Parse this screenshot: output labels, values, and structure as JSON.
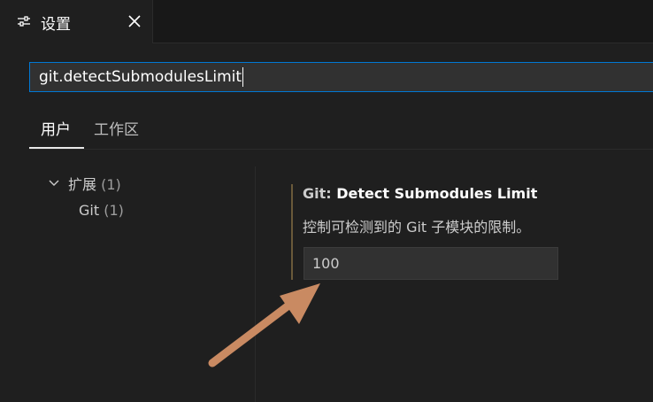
{
  "tab": {
    "title": "设置",
    "icon": "settings-sliders-icon",
    "close_icon": "close-icon"
  },
  "search": {
    "value": "git.detectSubmodulesLimit"
  },
  "scope_tabs": [
    {
      "label": "用户",
      "active": true
    },
    {
      "label": "工作区",
      "active": false
    }
  ],
  "toc": {
    "group": {
      "label": "扩展",
      "count": "(1)",
      "icon": "chevron-down-icon"
    },
    "child": {
      "label": "Git",
      "count": "(1)"
    }
  },
  "setting": {
    "category": "Git: ",
    "name": "Detect Submodules Limit",
    "description": "控制可检测到的 Git 子模块的限制。",
    "value": "100"
  },
  "colors": {
    "accent": "#0078d4",
    "modified_indicator": "#6a5a3a",
    "annotation_arrow": "#c98a62"
  }
}
